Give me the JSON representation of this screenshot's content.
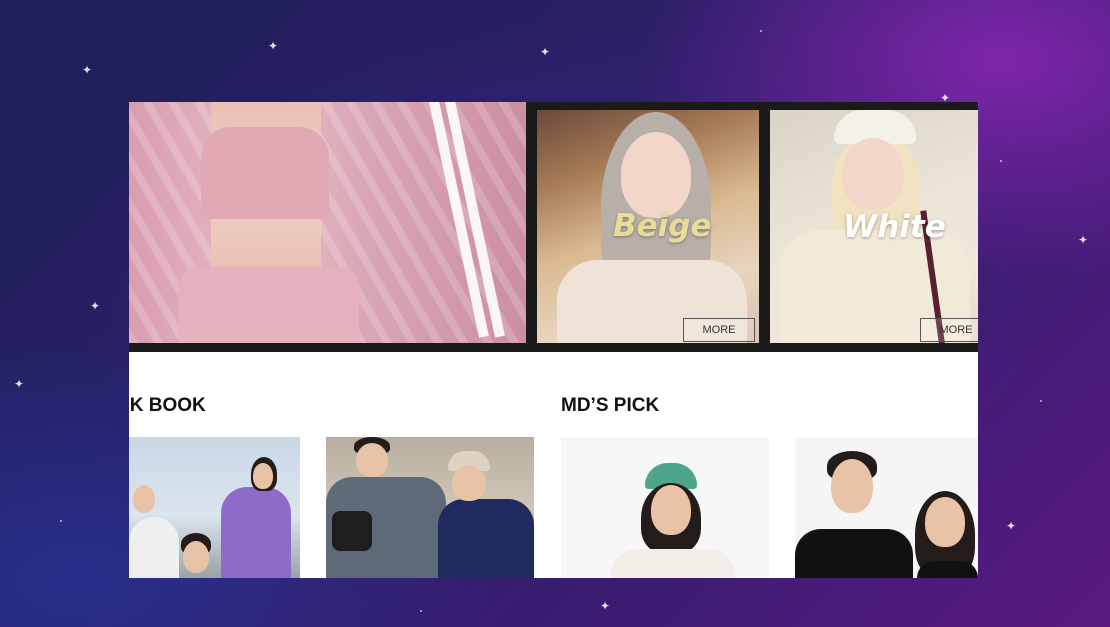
{
  "banner": {
    "promo_beige": {
      "word": "Beige",
      "more_label": "MORE"
    },
    "promo_white": {
      "word": "White",
      "more_label": "MORE"
    }
  },
  "sections": {
    "lookbook": {
      "title": "OK BOOK"
    },
    "mds_pick": {
      "title": "MD’S PICK"
    }
  },
  "colors": {
    "beige_text": "#e9dc9a",
    "white_text": "#ffffff",
    "hero_pink": "#d99db0",
    "cap_green": "#4fa58b"
  }
}
